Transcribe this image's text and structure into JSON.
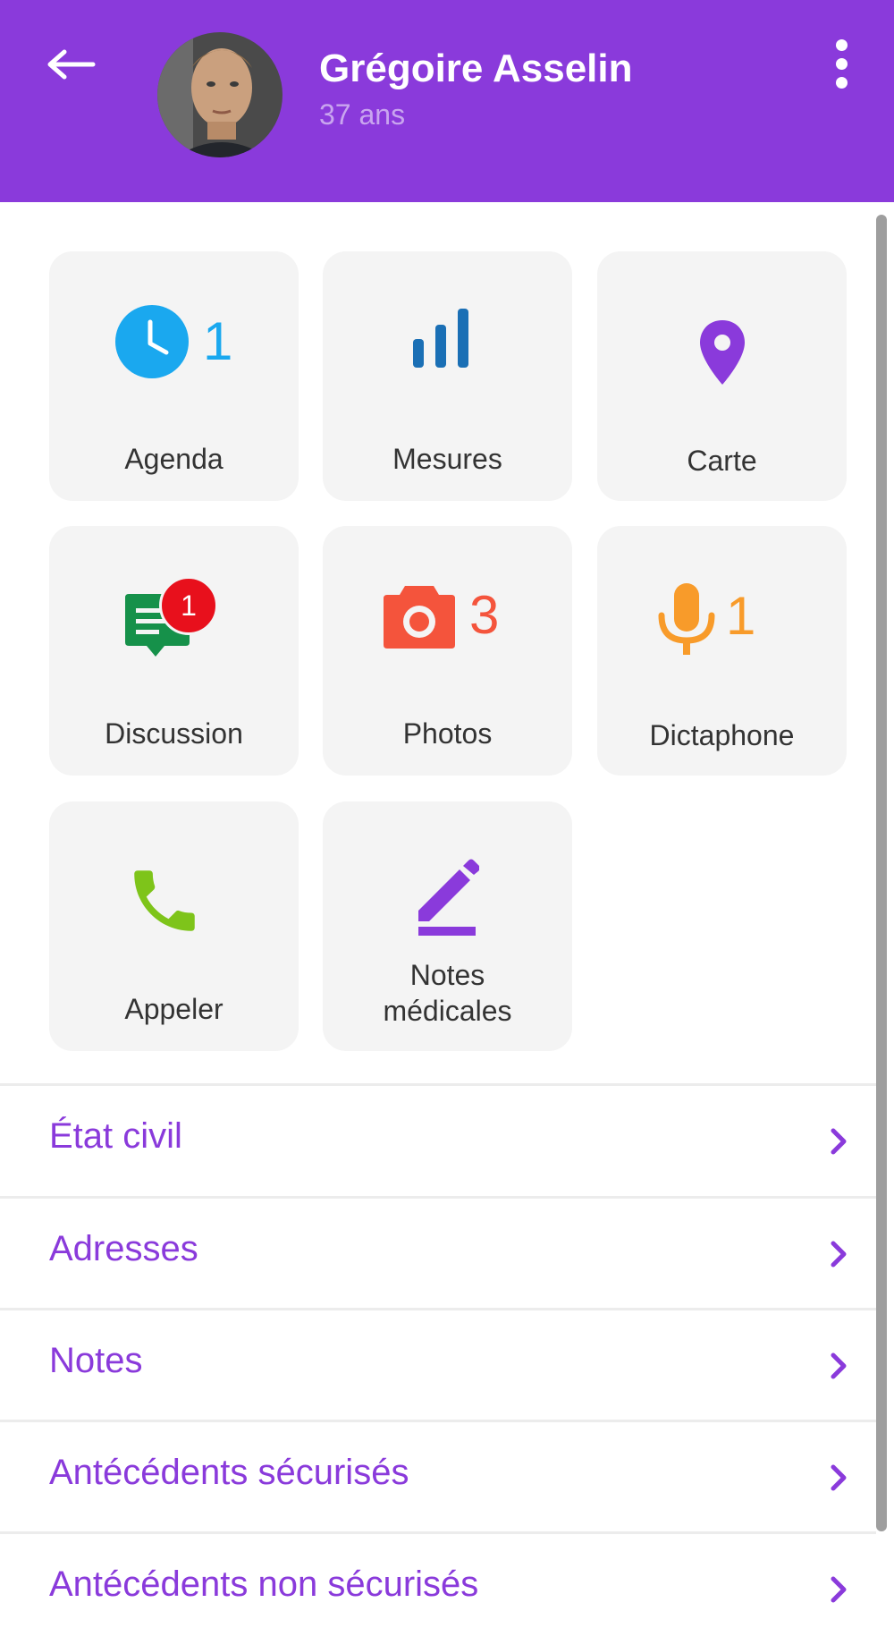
{
  "header": {
    "patient_name": "Grégoire Asselin",
    "patient_age": "37 ans",
    "background_color": "#8a3adb"
  },
  "tiles": [
    {
      "label": "Agenda",
      "icon": "clock-icon",
      "count": "1",
      "color": "#1aa8ef"
    },
    {
      "label": "Mesures",
      "icon": "bar-chart-icon",
      "count": "",
      "color": "#1a6fb5"
    },
    {
      "label": "Carte",
      "icon": "map-pin-icon",
      "count": "",
      "color": "#8a3adb"
    },
    {
      "label": "Discussion",
      "icon": "chat-icon",
      "badge": "1",
      "color": "#16914a",
      "badge_color": "#e8101c"
    },
    {
      "label": "Photos",
      "icon": "camera-icon",
      "count": "3",
      "color": "#f4543c"
    },
    {
      "label": "Dictaphone",
      "icon": "microphone-icon",
      "count": "1",
      "color": "#f89b2a"
    },
    {
      "label": "Appeler",
      "icon": "phone-icon",
      "count": "",
      "color": "#7ec41a"
    },
    {
      "label": "Notes\nmédicales",
      "icon": "pencil-icon",
      "count": "",
      "color": "#8a3adb"
    }
  ],
  "sections": [
    {
      "label": "État civil"
    },
    {
      "label": "Adresses"
    },
    {
      "label": "Notes"
    },
    {
      "label": "Antécédents sécurisés"
    },
    {
      "label": "Antécédents non sécurisés"
    }
  ]
}
